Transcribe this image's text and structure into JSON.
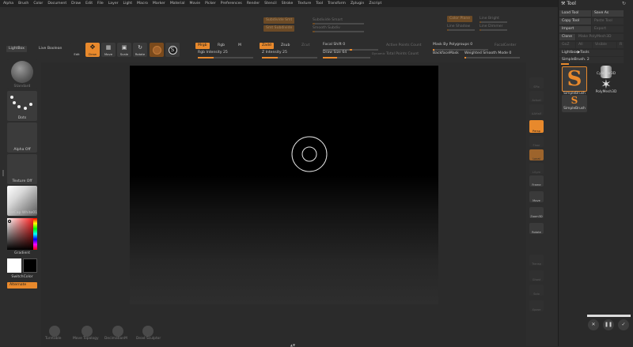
{
  "menu": [
    "Alpha",
    "Brush",
    "Color",
    "Document",
    "Draw",
    "Edit",
    "File",
    "Layer",
    "Light",
    "Macro",
    "Marker",
    "Material",
    "Movie",
    "Picker",
    "Preferences",
    "Render",
    "Stencil",
    "Stroke",
    "Texture",
    "Tool",
    "Transform",
    "Zplugin",
    "Zscript"
  ],
  "top": {
    "lightbox": "LightBox",
    "live_boolean": "Live Boolean",
    "tool_buttons": [
      "Edit",
      "Draw",
      "Move",
      "Scale",
      "Rotate"
    ],
    "mrgb": "Mrgb",
    "rgb": "Rgb",
    "m": "M",
    "rgb_intensity": "Rgb Intensity 25",
    "zadd": "Zadd",
    "zsub": "Zsub",
    "zcut": "Zcut",
    "z_intensity": "Z Intensity 25",
    "focal_shift": "Focal Shift 0",
    "draw_size": "Draw Size 64",
    "dynamic": "Dynamic",
    "active_points": "Active Points Count",
    "total_points": "Total Points Count",
    "mask_poly": "Mask By Polygroups 0",
    "backface": "BackfaceMask",
    "weighted_smooth": "Weighted Smooth Mode 0",
    "focal_center": "FocalCenter",
    "subdivide_smart": "Subdivide Smart",
    "smooth_subdiv": "Smooth Subdiv",
    "cursor_top_a": "Subdivide Smt",
    "cursor_top_b": "Smt Subdivide",
    "extras_a": "Color Plane",
    "extras_b": "Line Shadow",
    "extras_c": "Line Bright",
    "extras_d": "Line Dimmer"
  },
  "left": {
    "brush_label": "Standard",
    "stroke_label": "Dots",
    "alpha_label": "Alpha Off",
    "texture_label": "Texture Off",
    "material_label": "MatCap White01",
    "gradient_label": "Gradient",
    "switch_label": "SwitchColor",
    "alternate_label": "Alternate"
  },
  "right": {
    "buttons": [
      "SPix",
      "Actual",
      "AAHalf",
      "Persp",
      "Floor",
      "Local",
      "LSym",
      "Frame",
      "Move",
      "Zoom3D",
      "Rotate",
      "Transp",
      "Ghost",
      "Solo",
      "Xpose"
    ]
  },
  "tool": {
    "title": "Tool",
    "load": "Load Tool",
    "save_as": "Save As",
    "copy": "Copy Tool",
    "paste": "Paste Tool",
    "import": "Import",
    "export": "Export",
    "clone": "Clone",
    "make_polymesh": "Make PolyMesh3D",
    "goz": "GoZ",
    "all": "All",
    "visible": "Visible",
    "r": "R",
    "lightbox_tools": "Lightbox▶Tools",
    "current_tool": "SimpleBrush. 2",
    "thumbs": [
      "SimpleBrush",
      "Cylinder3D",
      "PolyMesh3D",
      "SimpleBrush"
    ]
  },
  "bottom": {
    "labels": [
      "Turntable",
      "Move Topology",
      "DecimationM",
      "Dead Sculptor"
    ]
  },
  "colors": {
    "accent": "#e8892c",
    "bg": "#2b2b2b",
    "panel": "#2d2d2d"
  }
}
